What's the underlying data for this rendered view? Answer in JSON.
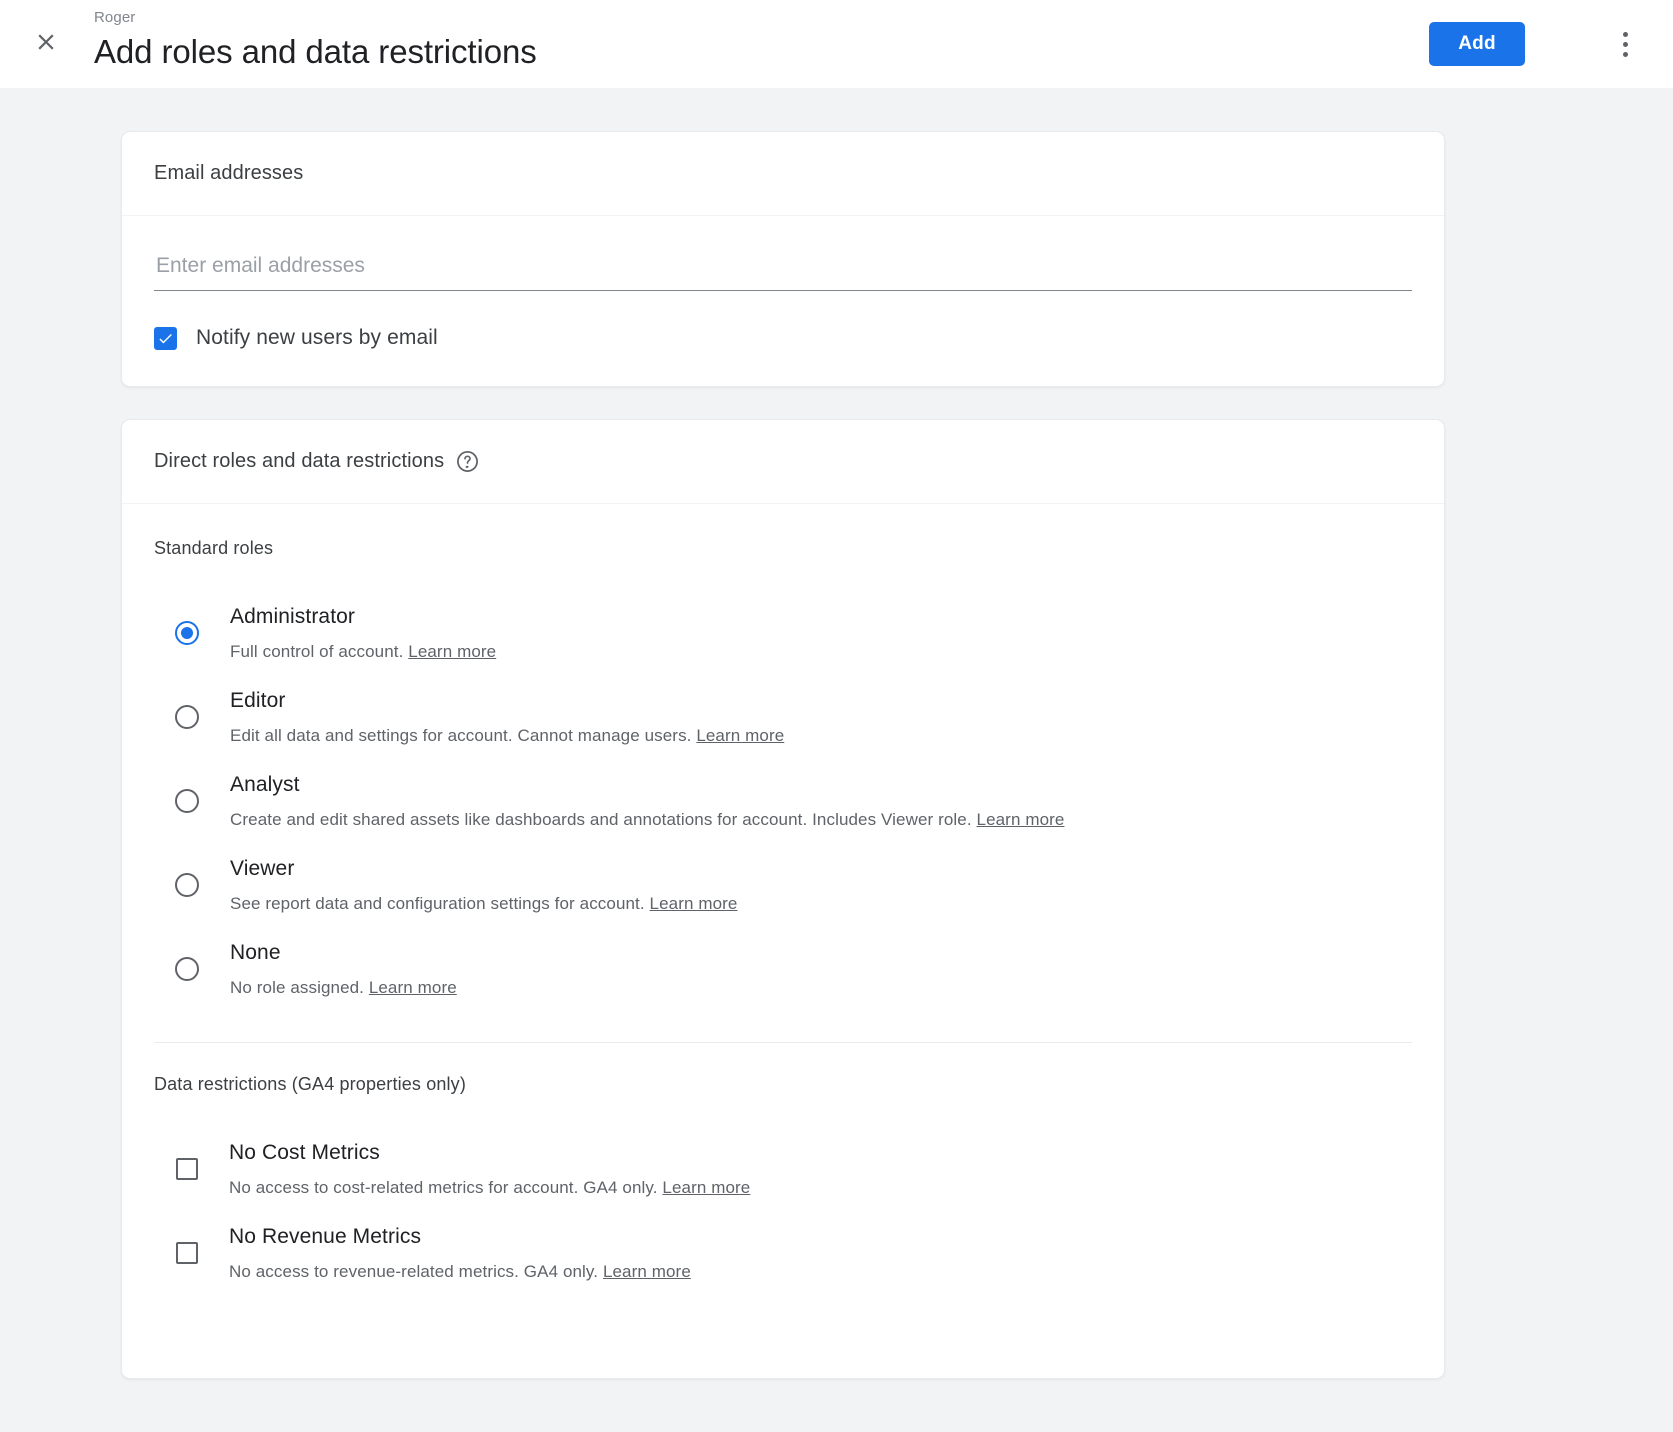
{
  "header": {
    "eyebrow": "Roger",
    "title": "Add roles and data restrictions",
    "close_icon": "close-icon",
    "add_label": "Add",
    "overflow_icon": "more-vert-icon",
    "accent_color": "#1a73e8"
  },
  "email_card": {
    "heading": "Email addresses",
    "input": {
      "placeholder": "Enter email addresses",
      "value": ""
    },
    "notify": {
      "label": "Notify new users by email",
      "checked": true
    }
  },
  "roles_card": {
    "heading": "Direct roles and data restrictions",
    "help_icon": "help-circle-icon",
    "standard_roles_label": "Standard roles",
    "selected_role": "Administrator",
    "learn_more_label": "Learn more",
    "roles": [
      {
        "title": "Administrator",
        "desc": "Full control of account.",
        "link": "Learn more",
        "selected": true
      },
      {
        "title": "Editor",
        "desc": "Edit all data and settings for account. Cannot manage users.",
        "link": "Learn more",
        "selected": false
      },
      {
        "title": "Analyst",
        "desc": "Create and edit shared assets like dashboards and annotations for account. Includes Viewer role.",
        "link": "Learn more",
        "selected": false
      },
      {
        "title": "Viewer",
        "desc": "See report data and configuration settings for account.",
        "link": "Learn more",
        "selected": false
      },
      {
        "title": "None",
        "desc": "No role assigned.",
        "link": "Learn more",
        "selected": false
      }
    ],
    "data_restrictions_label": "Data restrictions (GA4 properties only)",
    "restrictions": [
      {
        "title": "No Cost Metrics",
        "desc": "No access to cost-related metrics for account. GA4 only.",
        "link": "Learn more",
        "checked": false
      },
      {
        "title": "No Revenue Metrics",
        "desc": "No access to revenue-related metrics. GA4 only.",
        "link": "Learn more",
        "checked": false
      }
    ]
  }
}
